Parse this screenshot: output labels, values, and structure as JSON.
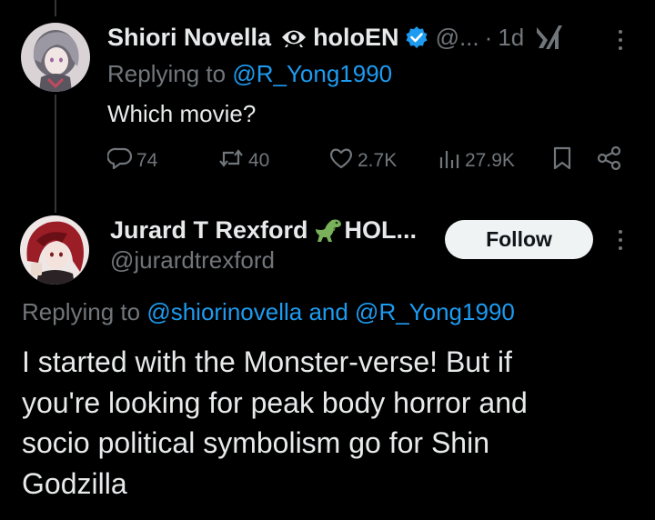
{
  "reply1": {
    "display_name": "Shiori Novella",
    "name_suffix": "holoEN",
    "handle": "@...",
    "separator": "·",
    "time": "1d",
    "replying_prefix": "Replying to",
    "replying_to": "@R_Yong1990",
    "text": "Which movie?",
    "stats": {
      "replies": "74",
      "retweets": "40",
      "likes": "2.7K",
      "views": "27.9K"
    }
  },
  "reply2": {
    "display_name": "Jurard T Rexford",
    "name_suffix": "HOL...",
    "handle": "@jurardtrexford",
    "follow_label": "Follow",
    "replying_prefix": "Replying to",
    "replying_to": "@shiorinovella and @R_Yong1990",
    "text": "I started with the Monster-verse! But if\nyou're looking for peak body horror and\nsocio political symbolism go for Shin\nGodzilla"
  },
  "colors": {
    "background": "#000000",
    "text": "#e7e9ea",
    "muted": "#71767b",
    "link": "#1d9bf0",
    "verified": "#1d9bf0",
    "follow_bg": "#eff3f4"
  },
  "icons": {
    "eye": "eye-icon",
    "verified": "verified-badge-icon",
    "dino": "dinosaur-emoji-icon",
    "grok": "grok-icon",
    "more": "more-icon",
    "reply": "reply-icon",
    "retweet": "retweet-icon",
    "like": "heart-icon",
    "views": "views-icon",
    "bookmark": "bookmark-icon",
    "share": "share-icon"
  }
}
